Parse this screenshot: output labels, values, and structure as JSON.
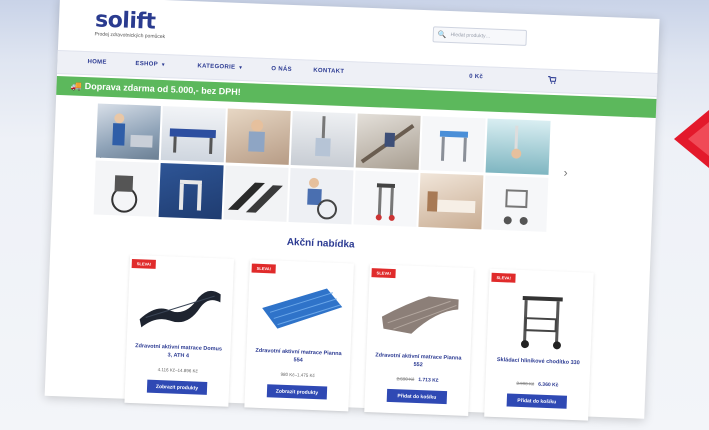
{
  "header": {
    "logo_text": "solift",
    "tagline": "Prodej zdravotnických pomůcek",
    "search_placeholder": "Hledat produkty…"
  },
  "nav": {
    "items": [
      {
        "label": "HOME",
        "has_dropdown": false
      },
      {
        "label": "ESHOP",
        "has_dropdown": true
      },
      {
        "label": "KATEGORIE",
        "has_dropdown": true
      },
      {
        "label": "O NÁS",
        "has_dropdown": false
      },
      {
        "label": "KONTAKT",
        "has_dropdown": false
      }
    ],
    "cart_amount": "0 Kč"
  },
  "banner": {
    "text": "Doprava zdarma od 5.000,- bez DPH!"
  },
  "section": {
    "title": "Akční nabídka"
  },
  "products": [
    {
      "badge": "SLEVA!",
      "name": "Zdravotní aktivní matrace Domus 3, ATH 4",
      "price_range": "4.116 Kč–14.896 Kč",
      "button": "Zobrazit produkty"
    },
    {
      "badge": "SLEVA!",
      "name": "Zdravotní aktivní matrace Pianna 554",
      "price_range": "980 Kč–1.475 Kč",
      "button": "Zobrazit produkty"
    },
    {
      "badge": "SLEVA!",
      "name": "Zdravotní aktivní matrace Pianna 552",
      "price_old": "2.590 Kč",
      "price_new": "1.713 Kč",
      "button": "Přidat do košíku"
    },
    {
      "badge": "SLEVA!",
      "name": "Skládací hliníkové chodítko 330",
      "price_old": "8.990 Kč",
      "price_new": "6.360 Kč",
      "button": "Přidat do košíku"
    }
  ],
  "colors": {
    "brand": "#2b3a92",
    "accent_red": "#e23636",
    "banner_green": "#5cb85c",
    "button_blue": "#2f49b4"
  },
  "icons": {
    "search": "search-icon",
    "cart": "cart-icon",
    "truck": "truck-icon",
    "prev": "chevron-left-icon",
    "next": "chevron-right-icon"
  }
}
